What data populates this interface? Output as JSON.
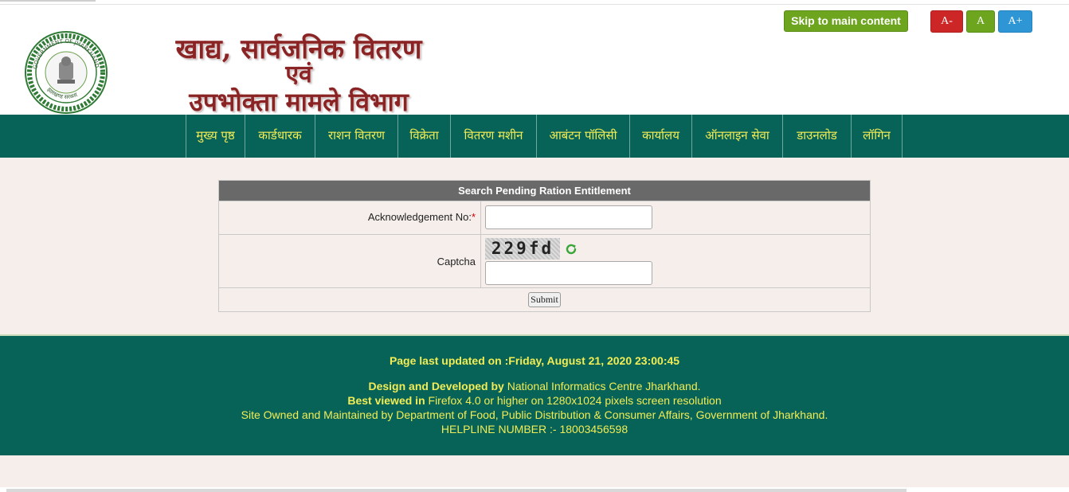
{
  "header": {
    "logo_line1": "खाद्य, सार्वजनिक वितरण",
    "logo_line2": "एवं",
    "logo_line3": "उपभोक्ता मामले विभाग",
    "emblem_top_text": "GOVERNMENT OF JHARKHAND",
    "emblem_bottom_text": "झारखण्ड सरकार",
    "skip_label": "Skip to main content",
    "font_decrease": "A-",
    "font_normal": "A",
    "font_increase": "A+"
  },
  "nav": {
    "items": [
      {
        "label": "मुख्य पृष्ठ"
      },
      {
        "label": "कार्डधारक"
      },
      {
        "label": "राशन वितरण"
      },
      {
        "label": "विक्रेता"
      },
      {
        "label": "वितरण मशीन"
      },
      {
        "label": "आबंटन पॉलिसी"
      },
      {
        "label": "कार्यालय"
      },
      {
        "label": "ऑनलाइन सेवा"
      },
      {
        "label": "डाउनलोड"
      },
      {
        "label": "लॉगिन"
      }
    ]
  },
  "form": {
    "title": "Search Pending Ration Entitlement",
    "ack_label": "Acknowledgement No:",
    "ack_required": "*",
    "ack_value": "",
    "captcha_label": "Captcha",
    "captcha_text": "229fd",
    "captcha_value": "",
    "submit_label": "Submit"
  },
  "footer": {
    "updated_text": "Page last updated on :Friday, August 21, 2020 23:00:45",
    "design_bold": "Design and Developed by",
    "design_text": " National Informatics Centre Jharkhand.",
    "best_bold": "Best viewed in",
    "best_text": " Firefox 4.0 or higher on 1280x1024 pixels screen resolution",
    "owned_text": "Site Owned and Maintained by Department of Food, Public Distribution & Consumer Affairs, Government of Jharkhand.",
    "helpline_text": "HELPLINE NUMBER :- 18003456598"
  },
  "colors": {
    "nav_bg": "#076357",
    "nav_text": "#f2ec55",
    "logo_text": "#8a2424",
    "skip_bg": "#6ea51e",
    "font_minus_bg": "#cd2626",
    "font_plus_bg": "#2f96d6",
    "form_header_bg": "#696969"
  }
}
